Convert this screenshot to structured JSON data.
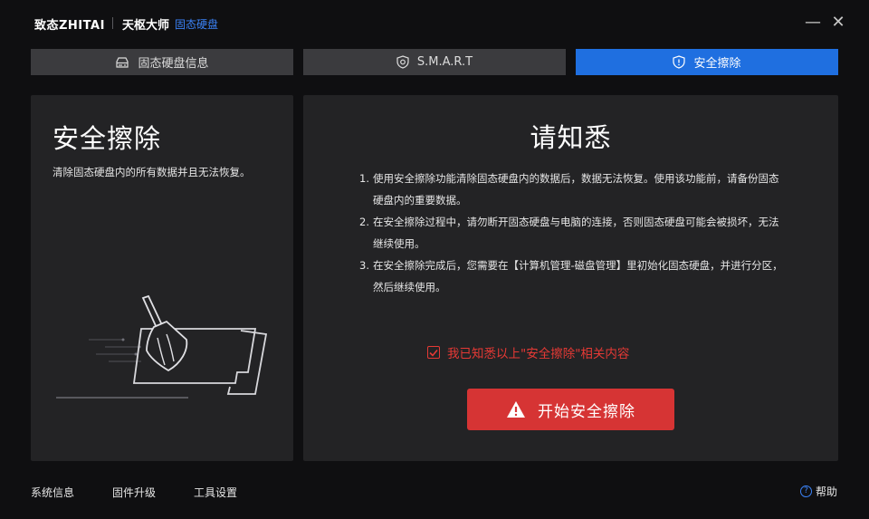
{
  "titlebar": {
    "brand": "致态ZHITAI",
    "app_name": "天枢大师",
    "app_sub": "固态硬盘",
    "minimize": "—",
    "close": "✕"
  },
  "tabs": [
    {
      "label": "固态硬盘信息",
      "icon": "drive-icon",
      "active": false
    },
    {
      "label": "S.M.A.R.T",
      "icon": "shield-icon",
      "active": false
    },
    {
      "label": "安全擦除",
      "icon": "shield-alert-icon",
      "active": true
    }
  ],
  "left_panel": {
    "title": "安全擦除",
    "description": "清除固态硬盘内的所有数据并且无法恢复。",
    "illustration": "broom-ssd-icon"
  },
  "notice": {
    "title": "请知悉",
    "items": [
      {
        "num": "1.",
        "text": "使用安全擦除功能清除固态硬盘内的数据后，数据无法恢复。使用该功能前，请备份固态硬盘内的重要数据。"
      },
      {
        "num": "2.",
        "text": "在安全擦除过程中，请勿断开固态硬盘与电脑的连接，否则固态硬盘可能会被损坏，无法继续使用。"
      },
      {
        "num": "3.",
        "text": "在安全擦除完成后，您需要在【计算机管理-磁盘管理】里初始化固态硬盘，并进行分区，然后继续使用。"
      }
    ],
    "agree_label": "我已知悉以上\"安全擦除\"相关内容",
    "agree_checked": true,
    "start_label": "开始安全擦除"
  },
  "footer": {
    "system_info": "系统信息",
    "firmware": "固件升级",
    "tools": "工具设置",
    "help": "帮助"
  },
  "colors": {
    "accent": "#1f6fe0",
    "danger": "#d63434",
    "warning_text": "#e53935",
    "panel": "#232325",
    "background": "#0f0f11"
  }
}
